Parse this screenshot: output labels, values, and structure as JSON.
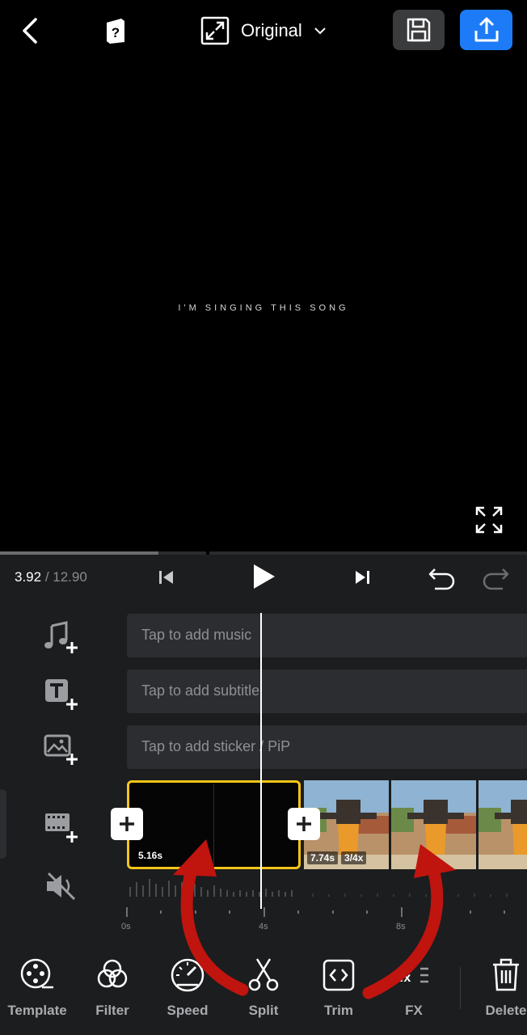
{
  "header": {
    "ratio_label": "Original",
    "icons": [
      "back-icon",
      "guide-icon",
      "aspect-ratio-icon",
      "chevron-down-icon",
      "save-draft-icon",
      "export-icon"
    ],
    "colors": {
      "export_button": "#1e7bf7",
      "save_button": "#3a3b3d"
    }
  },
  "preview": {
    "caption": "I'M SINGING THIS SONG",
    "progress_fraction": 0.3
  },
  "playback": {
    "current_time": "3.92",
    "separator": " / ",
    "total_time": "12.90",
    "icons": [
      "skip-previous-icon",
      "play-icon",
      "skip-next-icon",
      "undo-icon",
      "redo-icon"
    ]
  },
  "tracks": {
    "music_placeholder": "Tap to add music",
    "subtitle_placeholder": "Tap to add subtitle",
    "sticker_placeholder": "Tap to add sticker / PiP"
  },
  "clips": [
    {
      "duration": "5.16s",
      "selected": true,
      "border_color": "#f5c518"
    },
    {
      "duration": "7.74s",
      "speed": "3/4x"
    }
  ],
  "ruler": {
    "labels": [
      "0s",
      "4s",
      "8s"
    ]
  },
  "toolbar": {
    "items": [
      {
        "label": "Template",
        "icon": "template-icon"
      },
      {
        "label": "Filter",
        "icon": "filter-icon"
      },
      {
        "label": "Speed",
        "icon": "speed-icon"
      },
      {
        "label": "Split",
        "icon": "split-icon"
      },
      {
        "label": "Trim",
        "icon": "trim-icon"
      },
      {
        "label": "FX",
        "icon": "fx-icon"
      },
      {
        "label": "Delete",
        "icon": "delete-icon"
      }
    ]
  },
  "annotation": {
    "arrow_color": "#c0140f"
  }
}
